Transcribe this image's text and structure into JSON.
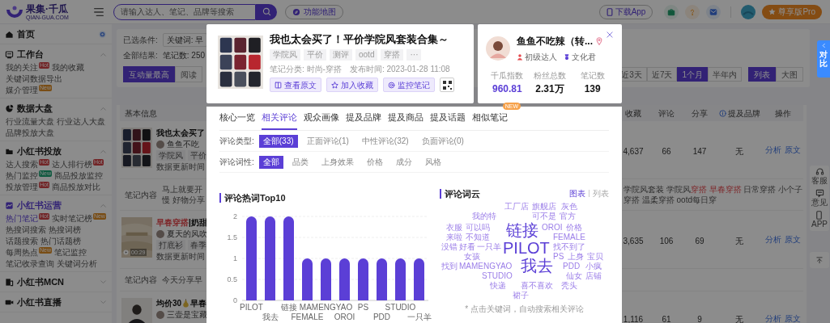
{
  "header": {
    "logo": "果集·千瓜",
    "logo_domain": "QIAN-GUA.COM",
    "search": {
      "placeholder": "请输入达人、笔记、品牌等搜索"
    },
    "feature_map": "功能地图",
    "download_app": "下载App",
    "upgrade": "尊享版Pro"
  },
  "sidebar": {
    "sections": [
      {
        "kind": "home",
        "label": "首页",
        "active": false
      },
      {
        "kind": "group",
        "label": "工作台",
        "active": false,
        "expanded": true,
        "links": [
          {
            "label": "我的关注",
            "selected": false,
            "badge": {
              "text": "Hot",
              "color": "#722426"
            }
          },
          {
            "label": "我的收藏",
            "selected": false
          },
          {
            "label": "关键词数据导出",
            "selected": false
          },
          {
            "label": "媒介管理",
            "selected": false,
            "badge": {
              "text": "New",
              "color": "#794d15"
            }
          }
        ]
      },
      {
        "kind": "group",
        "label": "数据大盘",
        "active": false,
        "expanded": true,
        "links": [
          {
            "label": "行业流量大盘",
            "selected": false
          },
          {
            "label": "行业达人大盘",
            "selected": false
          },
          {
            "label": "品牌投放大盘",
            "selected": false
          }
        ]
      },
      {
        "kind": "group",
        "label": "小红书投放",
        "active": false,
        "expanded": true,
        "links": [
          {
            "label": "达人搜索",
            "selected": false,
            "badge": {
              "text": "Hot",
              "color": "#722426"
            }
          },
          {
            "label": "达人排行榜",
            "selected": false,
            "badge": {
              "text": "Hot",
              "color": "#722426"
            }
          },
          {
            "label": "热门监控",
            "selected": false,
            "badge": {
              "text": "New",
              "color": "#0f593f"
            }
          },
          {
            "label": "商品投放监控",
            "selected": false
          },
          {
            "label": "投放管理",
            "selected": false,
            "badge": {
              "text": "Hot",
              "color": "#722426"
            }
          },
          {
            "label": "商品投放对比",
            "selected": false
          }
        ]
      },
      {
        "kind": "group",
        "label": "小红书运营",
        "active": true,
        "expanded": true,
        "links": [
          {
            "label": "热门笔记",
            "selected": true,
            "badge": {
              "text": "Hot",
              "color": "#722426"
            }
          },
          {
            "label": "实时笔记榜",
            "selected": false,
            "badge": {
              "text": "New",
              "color": "#794d15"
            }
          },
          {
            "label": "热搜词搜索",
            "selected": false
          },
          {
            "label": "热搜词榜",
            "selected": false
          },
          {
            "label": "话题搜索",
            "selected": false
          },
          {
            "label": "热门话题榜",
            "selected": false
          },
          {
            "label": "每周热点",
            "selected": false,
            "badge": {
              "text": "New",
              "color": "#794d15"
            }
          },
          {
            "label": "笔记监控",
            "selected": false
          },
          {
            "label": "笔记收录查询",
            "selected": false
          },
          {
            "label": "关键词分析",
            "selected": false
          }
        ]
      },
      {
        "kind": "group",
        "label": "小红书MCN",
        "active": false,
        "expanded": false
      },
      {
        "kind": "group",
        "label": "小红书直播",
        "active": false,
        "expanded": false
      }
    ]
  },
  "filters": {
    "conditions_label": "已选条件:",
    "conditions_value": "关键词: 早",
    "results_label": "全部结果:",
    "results_value": "笔记数: 250"
  },
  "sort_tabs": [
    {
      "label": "互动量最高",
      "selected": true
    },
    {
      "label": "阅读",
      "selected": false
    }
  ],
  "time_tabs": [
    {
      "label": "近3天",
      "selected": false
    },
    {
      "label": "近7天",
      "selected": false
    },
    {
      "label": "1个月",
      "selected": true
    },
    {
      "label": "半年内",
      "selected": false
    }
  ],
  "view_tabs": [
    {
      "label": "列表",
      "selected": true
    },
    {
      "label": "大图",
      "selected": false
    }
  ],
  "table": {
    "columns": [
      "基本信息",
      "收藏",
      "评论",
      "分享",
      "提及品牌",
      "操作"
    ],
    "rows": [
      {
        "title": [
          {
            "text": "我也太会买了",
            "highlight": false
          }
        ],
        "author": "鱼鱼不吃",
        "tags": [
          "学院风",
          "平价"
        ],
        "updated": "数据更新时间",
        "collects": "4,637",
        "comments": "66",
        "shares": "147",
        "brands": "无",
        "actions": [
          "分析",
          "原文"
        ],
        "content_label": "笔记内容",
        "content_lines": [
          "马上就要开",
          "慢 好物分享"
        ],
        "hashtags": [
          {
            "text": "学院风套装 学院风",
            "highlight": false
          },
          {
            "text": "穿搭 早春穿搭",
            "highlight": true
          },
          {
            "text": " 日常穿搭 小个子穿搭 温柔穿搭 ootd每日穿",
            "highlight": false
          }
        ]
      },
      {
        "title": [
          {
            "text": "早春穿搭",
            "highlight": true
          },
          {
            "text": "|奶甜",
            "highlight": false
          }
        ],
        "author": "夏天的风吹",
        "tags": [
          "打底衫",
          "春季"
        ],
        "updated": "数据更新时间",
        "video_duration": "00:29",
        "collects": "3,635",
        "comments": "106",
        "shares": "69",
        "brands": "无",
        "actions": [
          "分析",
          "原文"
        ],
        "content_label": "笔记内容",
        "content_lines": [
          "今天分享早"
        ]
      },
      {
        "title": [
          {
            "text": "均价30",
            "highlight": false
          },
          {
            "kind": "icon"
          },
          {
            "text": "早春",
            "highlight": false
          }
        ],
        "author": "三壶是宝藏",
        "collects": "1,116",
        "comments": "61",
        "shares": "9",
        "brands": "无",
        "actions": [
          "分析",
          "原文"
        ]
      }
    ]
  },
  "note_card": {
    "title": "我也太会买了！平价学院风套装合集～",
    "tags": [
      "学院风",
      "平价",
      "测评",
      "ootd",
      "穿搭",
      "···"
    ],
    "category": "笔记分类: 时尚-穿搭",
    "published": "发布时间: 2023-01-28 11:08",
    "buttons": [
      "查看原文",
      "加入收藏",
      "监控笔记"
    ]
  },
  "profile_card": {
    "name": "鱼鱼不吃辣（转...",
    "badges": [
      "初级达人",
      "文化君"
    ],
    "stats": [
      {
        "label": "千瓜指数",
        "value": "960.81",
        "highlight": true
      },
      {
        "label": "粉丝总数",
        "value": "2.31万",
        "highlight": false
      },
      {
        "label": "笔记数",
        "value": "139",
        "highlight": false
      }
    ]
  },
  "detail_panel": {
    "tabs": [
      {
        "label": "核心一览",
        "selected": false
      },
      {
        "label": "相关评论",
        "selected": true
      },
      {
        "label": "观众画像",
        "selected": false
      },
      {
        "label": "提及品牌",
        "selected": false
      },
      {
        "label": "提及商品",
        "selected": false
      },
      {
        "label": "提及话题",
        "selected": false
      },
      {
        "label": "相似笔记",
        "selected": false,
        "badge": "NEW"
      }
    ],
    "comment_type": {
      "label": "评论类型:",
      "options": [
        {
          "label": "全部(33)",
          "selected": true
        },
        {
          "label": "正面评论(1)",
          "selected": false
        },
        {
          "label": "中性评论(32)",
          "selected": false
        },
        {
          "label": "负面评论(0)",
          "selected": false
        }
      ]
    },
    "comment_aspect": {
      "label": "评论词性:",
      "options": [
        {
          "label": "全部",
          "selected": true
        },
        {
          "label": "品类",
          "selected": false
        },
        {
          "label": "上身效果",
          "selected": false
        },
        {
          "label": "价格",
          "selected": false
        },
        {
          "label": "成分",
          "selected": false
        },
        {
          "label": "风格",
          "selected": false
        }
      ]
    },
    "hot_words": {
      "title": "评论热词Top10",
      "chart_data": {
        "type": "bar",
        "categories": [
          "PILOT",
          "我去",
          "链接",
          "FEMALE",
          "MAMENGYAO",
          "OROI",
          "PS",
          "PDD",
          "STUDIO",
          "一只羊"
        ],
        "values": [
          2,
          2,
          2,
          1,
          1,
          1,
          1,
          1,
          1,
          1
        ],
        "ylim": [
          0,
          2
        ],
        "yticks": [
          0,
          0.5,
          1,
          1.5,
          2
        ],
        "grid": true
      }
    },
    "word_cloud": {
      "title": "评论词云",
      "views": [
        {
          "label": "图表",
          "selected": true
        },
        {
          "label": "列表",
          "selected": false
        }
      ],
      "words": [
        {
          "text": "工厂店",
          "kind": "small"
        },
        {
          "text": "旗舰店",
          "kind": "small"
        },
        {
          "text": "灰色",
          "kind": "small"
        },
        {
          "text": "我的特",
          "kind": "small"
        },
        {
          "text": "可不是",
          "kind": "small"
        },
        {
          "text": "官方",
          "kind": "small"
        },
        {
          "text": "衣服",
          "kind": "small"
        },
        {
          "text": "可以吗",
          "kind": "small"
        },
        {
          "text": "链接",
          "kind": "large"
        },
        {
          "text": "OROI",
          "kind": "small"
        },
        {
          "text": "价格",
          "kind": "small"
        },
        {
          "text": "来啦",
          "kind": "small"
        },
        {
          "text": "不知道",
          "kind": "small"
        },
        {
          "text": "FEMALE",
          "kind": "small"
        },
        {
          "text": "没错",
          "kind": "small"
        },
        {
          "text": "好看",
          "kind": "small"
        },
        {
          "text": "一只羊",
          "kind": "small"
        },
        {
          "text": "PILOT",
          "kind": "large"
        },
        {
          "text": "找不到了",
          "kind": "small"
        },
        {
          "text": "女孩",
          "kind": "small"
        },
        {
          "text": "PS",
          "kind": "small"
        },
        {
          "text": "上身",
          "kind": "small"
        },
        {
          "text": "宝贝",
          "kind": "small"
        },
        {
          "text": "找到",
          "kind": "small"
        },
        {
          "text": "MAMENGYAO",
          "kind": "small"
        },
        {
          "text": "我去",
          "kind": "large"
        },
        {
          "text": "PDD",
          "kind": "small"
        },
        {
          "text": "小疯",
          "kind": "small"
        },
        {
          "text": "STUDIO",
          "kind": "small"
        },
        {
          "text": "仙女",
          "kind": "small"
        },
        {
          "text": "店铺",
          "kind": "small"
        },
        {
          "text": "快递",
          "kind": "small"
        },
        {
          "text": "喜不喜欢",
          "kind": "small"
        },
        {
          "text": "秃头",
          "kind": "small"
        },
        {
          "text": "裙子",
          "kind": "small"
        }
      ],
      "hint": "* 点击关键词，自动搜索相关评论"
    }
  },
  "side_tools": {
    "compare": "对比",
    "items": [
      "客服",
      "意见",
      "APP"
    ]
  }
}
